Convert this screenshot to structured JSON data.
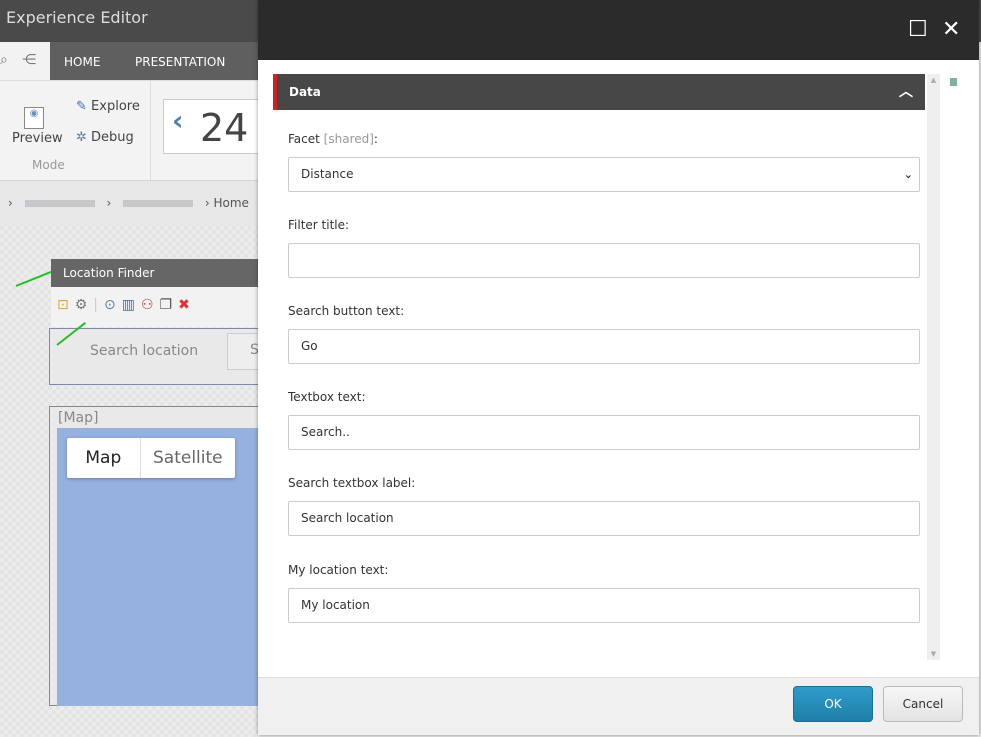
{
  "app": {
    "title": "Experience Editor",
    "tabs": [
      "HOME",
      "PRESENTATION"
    ],
    "ribbon": {
      "preview": "Preview",
      "explore": "Explore",
      "debug": "Debug",
      "group": "Mode",
      "counter": "24"
    },
    "breadcrumb": {
      "last": "Home"
    }
  },
  "page": {
    "rendering_title": "Location Finder",
    "search_label": "Search location",
    "search_btn": "S",
    "map_label": "[Map]",
    "map_types": [
      "Map",
      "Satellite"
    ]
  },
  "dialog": {
    "section_title": "Data",
    "fields": [
      {
        "label": "Facet",
        "label_suffix": "[shared]",
        "colon": ":",
        "type": "select",
        "value": "Distance"
      },
      {
        "label": "Filter title:",
        "value": ""
      },
      {
        "label": "Search button text:",
        "value": "Go"
      },
      {
        "label": "Textbox text:",
        "value": "Search.."
      },
      {
        "label": "Search textbox label:",
        "value": "Search location"
      },
      {
        "label": "My location text:",
        "value": "My location"
      }
    ],
    "ok": "OK",
    "cancel": "Cancel"
  },
  "colors": {
    "accent": "#d42020",
    "ok": "#2388b6",
    "header": "#2b2b2b"
  }
}
